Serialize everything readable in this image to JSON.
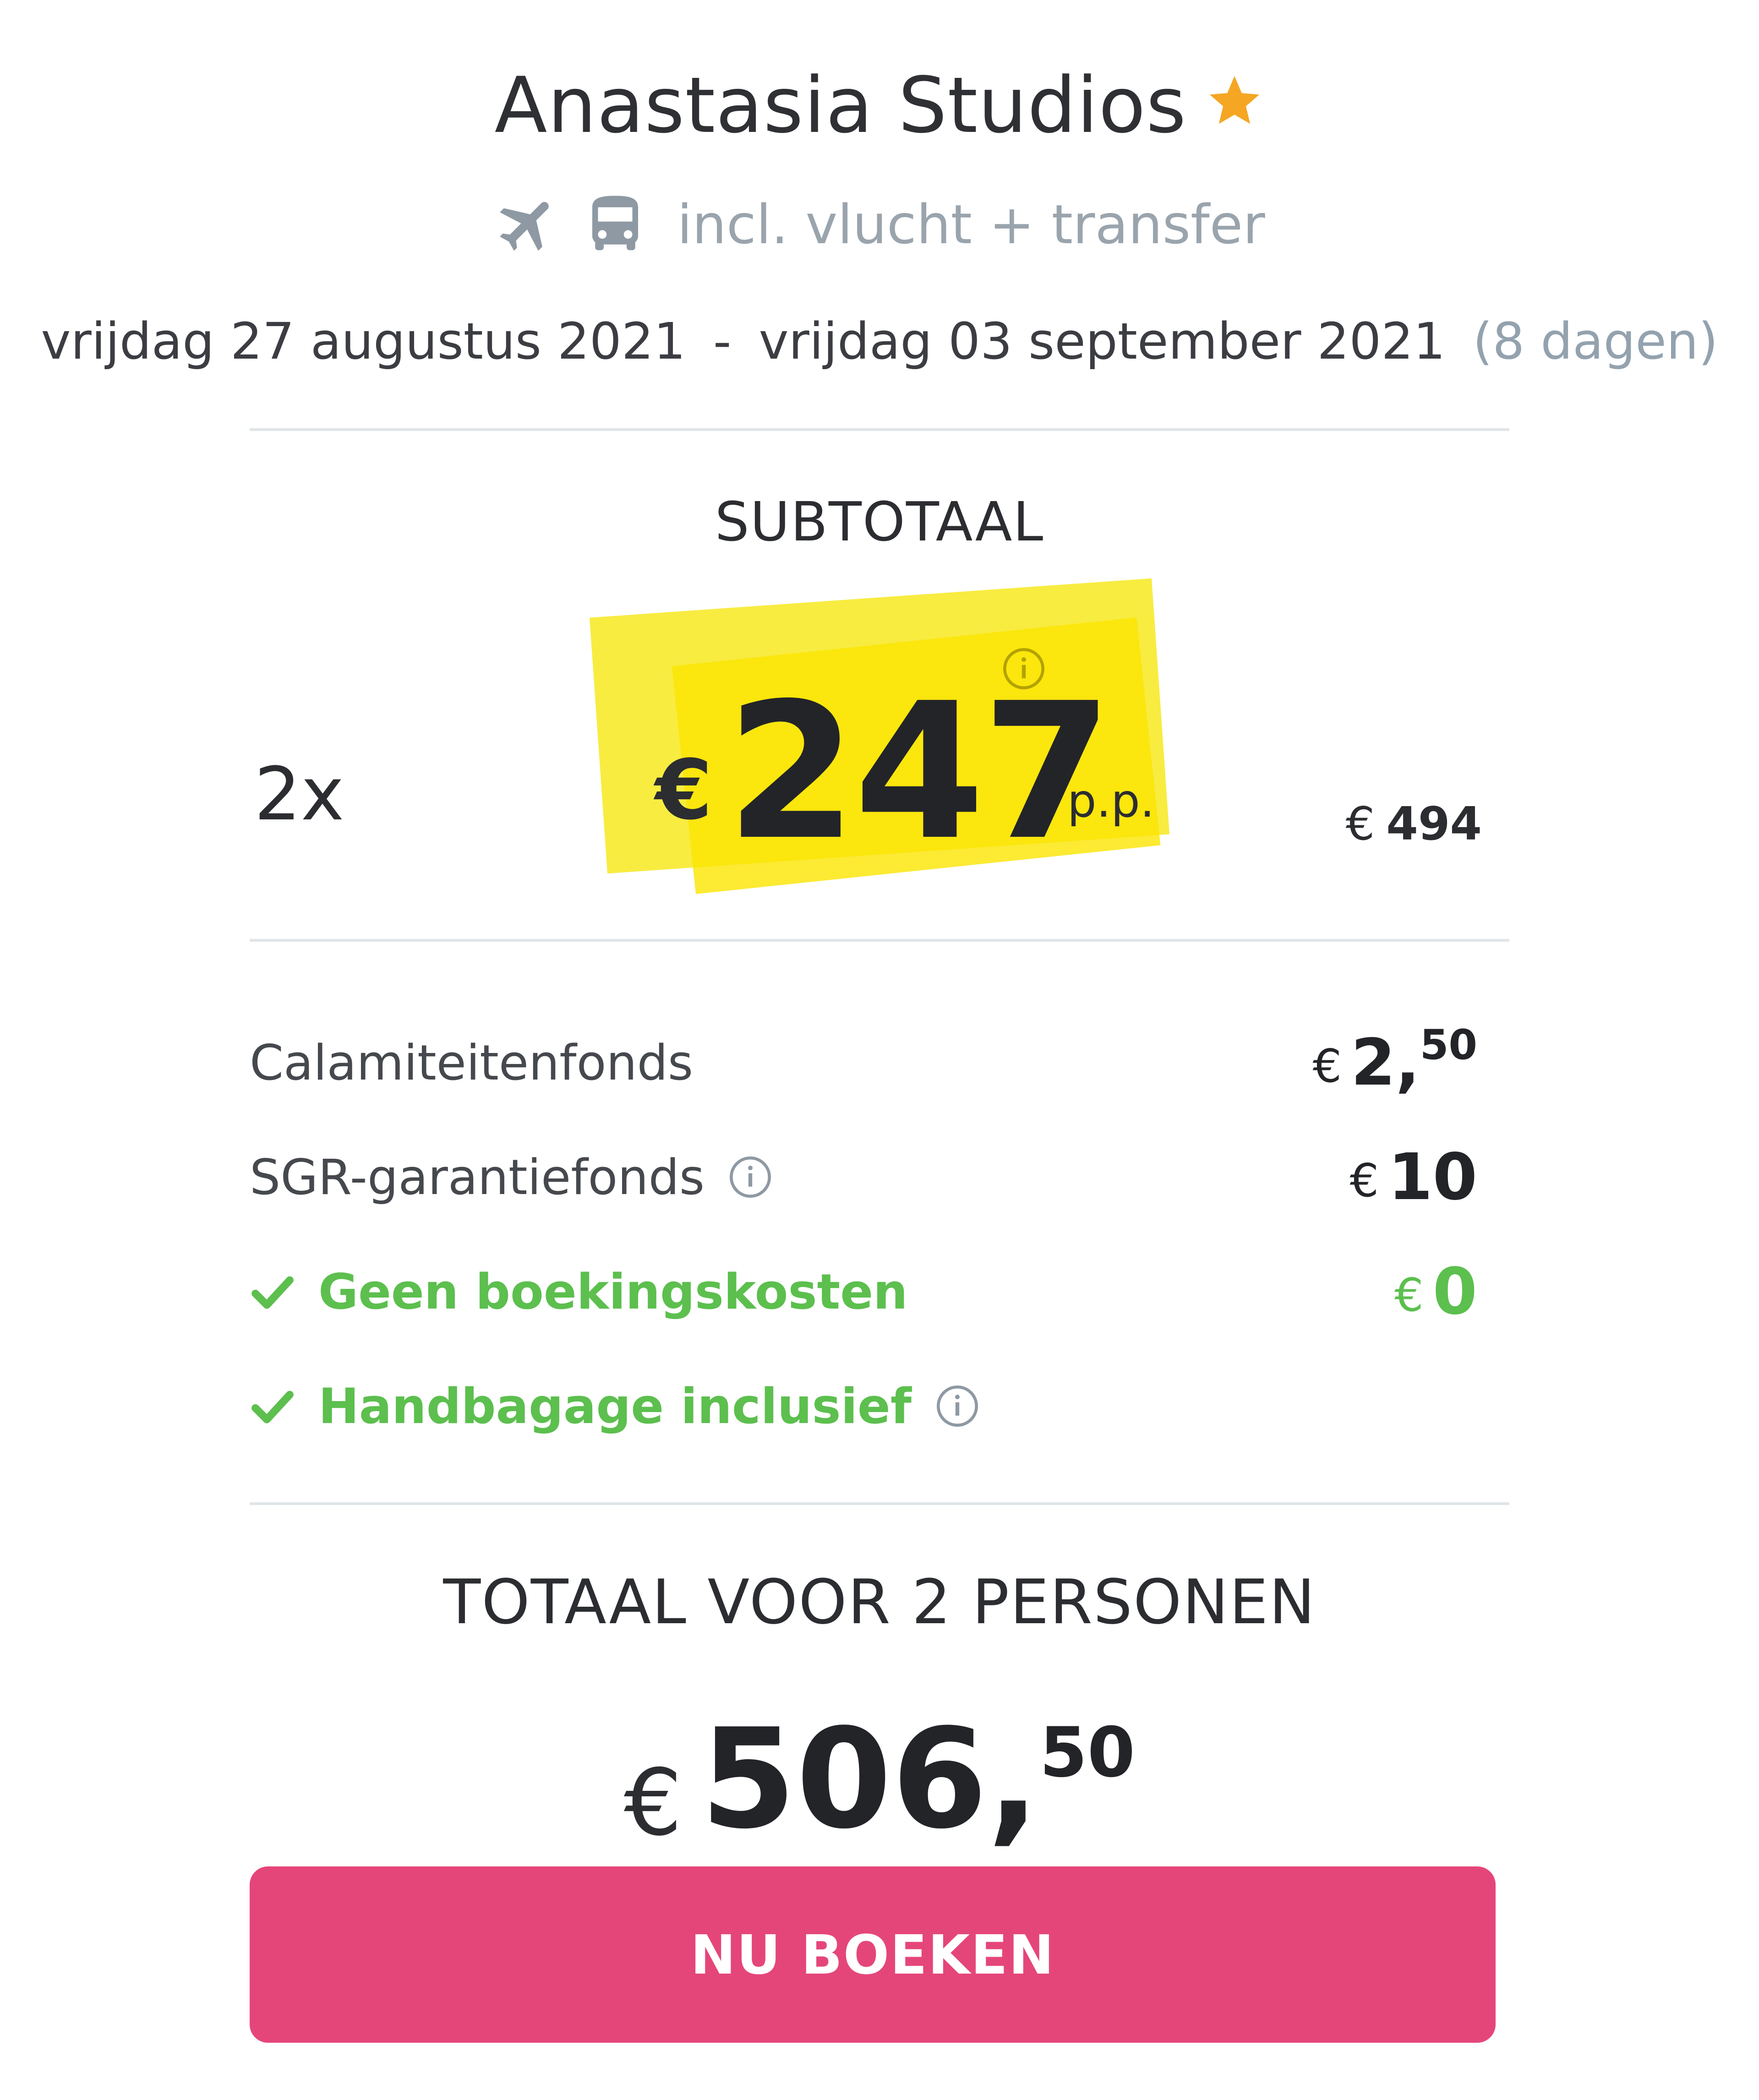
{
  "hotel": {
    "name": "Anastasia Studios",
    "includes": "incl. vlucht + transfer"
  },
  "dates": {
    "from": "vrijdag 27 augustus 2021",
    "separator": "-",
    "to": "vrijdag 03 september 2021",
    "duration": "(8 dagen)"
  },
  "subtotal": {
    "label": "SUBTOTAAL",
    "multiplier": "2x",
    "currency": "€",
    "price_pp": "247",
    "pp_label": "p.p.",
    "line_total": "494"
  },
  "fees": [
    {
      "label": "Calamiteitenfonds",
      "currency": "€",
      "amount": "2,",
      "cents": "50"
    },
    {
      "label": "SGR-garantiefonds",
      "currency": "€",
      "amount": "10",
      "cents": ""
    },
    {
      "label": "Geen boekingskosten",
      "currency": "€",
      "amount": "0",
      "cents": ""
    },
    {
      "label": "Handbagage inclusief"
    }
  ],
  "total": {
    "label": "TOTAAL VOOR 2 PERSONEN",
    "currency": "€",
    "amount": "506,",
    "cents": "50"
  },
  "book_button": {
    "label": "NU BOEKEN"
  },
  "colors": {
    "accent_pink": "#e5467a",
    "highlight_yellow": "#fbe500",
    "success_green": "#5cbf4e",
    "star_orange": "#f5a623",
    "muted": "#93a2ae"
  },
  "icons": [
    "star-icon",
    "plane-icon",
    "bus-icon",
    "info-icon",
    "check-icon"
  ]
}
